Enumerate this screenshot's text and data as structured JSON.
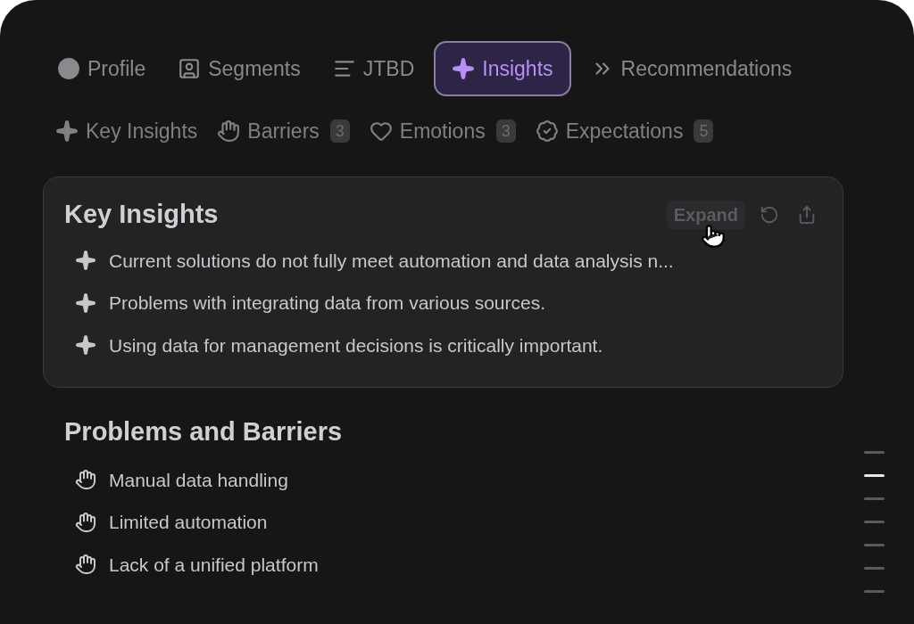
{
  "tabs": [
    {
      "kind": "profile",
      "label": "Profile",
      "selected": false
    },
    {
      "kind": "segments",
      "label": "Segments",
      "selected": false
    },
    {
      "kind": "jtbd",
      "label": "JTBD",
      "selected": false
    },
    {
      "kind": "insights",
      "label": "Insights",
      "selected": true
    },
    {
      "kind": "recommendations",
      "label": "Recommendations",
      "selected": false
    }
  ],
  "subtabs": [
    {
      "kind": "key",
      "label": "Key Insights"
    },
    {
      "kind": "barriers",
      "label": "Barriers",
      "count": "3"
    },
    {
      "kind": "emotions",
      "label": "Emotions",
      "count": "3"
    },
    {
      "kind": "expectations",
      "label": "Expectations",
      "count": "5"
    }
  ],
  "key_insights": {
    "title": "Key Insights",
    "expand_label": "Expand",
    "items": [
      "Current solutions do not fully meet automation and data analysis n...",
      "Problems with integrating data from various sources.",
      "Using data for management decisions is critically important."
    ]
  },
  "barriers": {
    "title": "Problems and Barriers",
    "items": [
      "Manual data handling",
      "Limited automation",
      "Lack of a unified platform"
    ]
  },
  "section_markers": [
    {
      "selected": false
    },
    {
      "selected": true
    },
    {
      "selected": false
    },
    {
      "selected": false
    },
    {
      "selected": false
    },
    {
      "selected": false
    },
    {
      "selected": false
    }
  ]
}
